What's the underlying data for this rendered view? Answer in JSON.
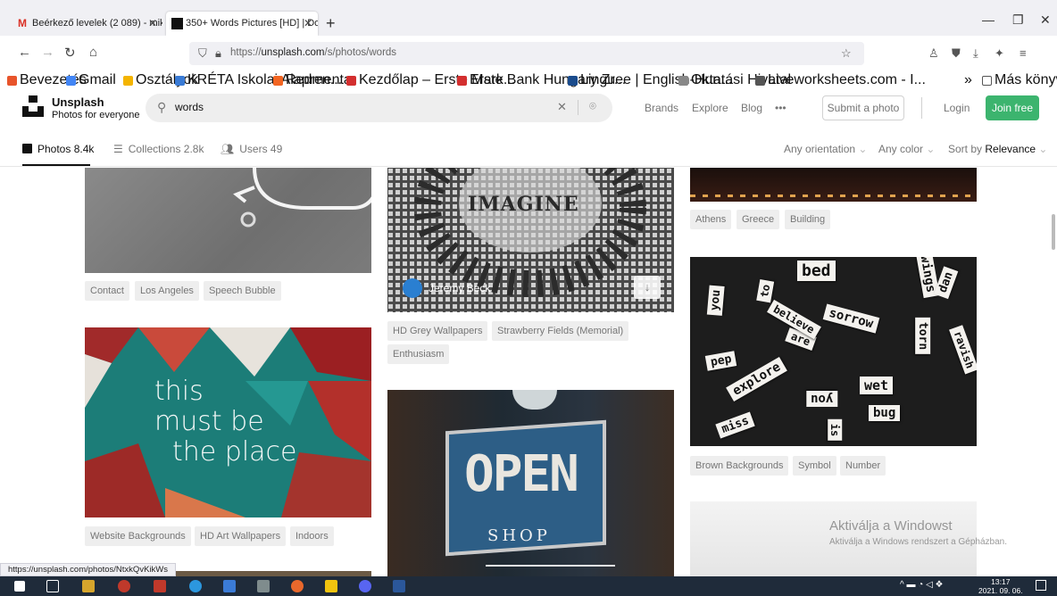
{
  "browser": {
    "tabs": [
      {
        "label": "Beérkező levelek (2 089) - miko",
        "icon": "gmail-icon"
      },
      {
        "label": "350+ Words Pictures [HD] | Do",
        "icon": "unsplash-icon"
      }
    ],
    "url_prefix": "https://",
    "url_domain": "unsplash.com",
    "url_path": "/s/photos/words",
    "bookmarks": [
      {
        "label": "Bevezetés",
        "color": "#e8542b"
      },
      {
        "label": "Gmail",
        "color": "#4285f4"
      },
      {
        "label": "Osztályok",
        "color": "#f4b400"
      },
      {
        "label": "KRÉTA Iskolai Alapren...",
        "color": "#3a7bd5"
      },
      {
        "label": "Redmenta",
        "color": "#f26522"
      },
      {
        "label": "Kezdőlap – Erste Mark...",
        "color": "#d32f2f"
      },
      {
        "label": "Erste Bank Hungary Zr...",
        "color": "#d32f2f"
      },
      {
        "label": "Linguee | English-Hun...",
        "color": "#1a4b8c"
      },
      {
        "label": "Oktatási Hivatal",
        "color": "#888888"
      },
      {
        "label": "Liveworksheets.com - I...",
        "color": "#555555"
      }
    ],
    "other_bookmarks": "Más könyvjelzők",
    "status_link": "https://unsplash.com/photos/NtxkQvKikWs"
  },
  "header": {
    "brand": "Unsplash",
    "tagline": "Photos for everyone",
    "search_value": "words",
    "links": [
      "Brands",
      "Explore",
      "Blog",
      "•••"
    ],
    "submit": "Submit a photo",
    "login": "Login",
    "join": "Join free"
  },
  "subnav": {
    "photos": "Photos 8.4k",
    "collections": "Collections 2.8k",
    "users": "Users 49",
    "orientation": "Any orientation",
    "color": "Any color",
    "sort_prefix": "Sort by",
    "sort_value": "Relevance"
  },
  "photos": {
    "col1_tags_a": [
      "Contact",
      "Los Angeles",
      "Speech Bubble"
    ],
    "col1_photo_b_text": [
      "this",
      "must be",
      "the place"
    ],
    "col1_tags_b": [
      "Website Backgrounds",
      "HD Art Wallpapers",
      "Indoors"
    ],
    "col2_photo_a_text": "IMAGINE",
    "col2_author": "Jeremy Beck",
    "col2_tags_a": [
      "HD Grey Wallpapers",
      "Strawberry Fields (Memorial)",
      "Enthusiasm"
    ],
    "col2_photo_b_sign": "OPEN",
    "col2_photo_b_sub": "SHOP",
    "col3_tags_a": [
      "Athens",
      "Greece",
      "Building"
    ],
    "col3_words": [
      "bed",
      "wings",
      "you",
      "to",
      "sorrow",
      "dan",
      "torn",
      "pep",
      "explore",
      "ravish",
      "wet",
      "you",
      "bug",
      "miss",
      "is",
      "are",
      "believe"
    ],
    "col3_tags_b": [
      "Brown Backgrounds",
      "Symbol",
      "Number"
    ]
  },
  "windows": {
    "activate_title": "Aktiválja a Windowst",
    "activate_sub": "Aktiválja a Windows rendszert a Gépházban.",
    "time": "13:17",
    "date": "2021. 09. 06."
  }
}
